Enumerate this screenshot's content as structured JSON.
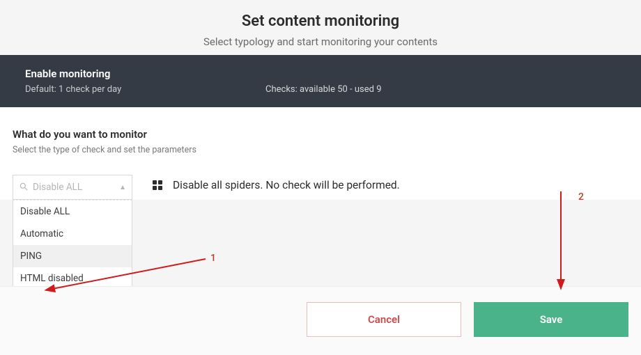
{
  "header": {
    "title": "Set content monitoring",
    "subtitle": "Select typology and start monitoring your contents"
  },
  "darkbar": {
    "enable_title": "Enable monitoring",
    "enable_sub": "Default: 1 check per day",
    "checks_text": "Checks: available 50 - used 9"
  },
  "section": {
    "title": "What do you want to monitor",
    "subtitle": "Select the type of check and set the parameters"
  },
  "select": {
    "placeholder": "Disable ALL",
    "options": [
      "Disable ALL",
      "Automatic",
      "PING",
      "HTML disabled"
    ],
    "hover_index": 2
  },
  "description": {
    "text": "Disable all spiders. No check will be performed."
  },
  "footer": {
    "cancel": "Cancel",
    "save": "Save"
  },
  "annotations": {
    "one": "1",
    "two": "2"
  },
  "colors": {
    "accent_green": "#4bb38a",
    "accent_red": "#d24a4a",
    "dark": "#353b45",
    "arrow": "#d11b1b"
  }
}
